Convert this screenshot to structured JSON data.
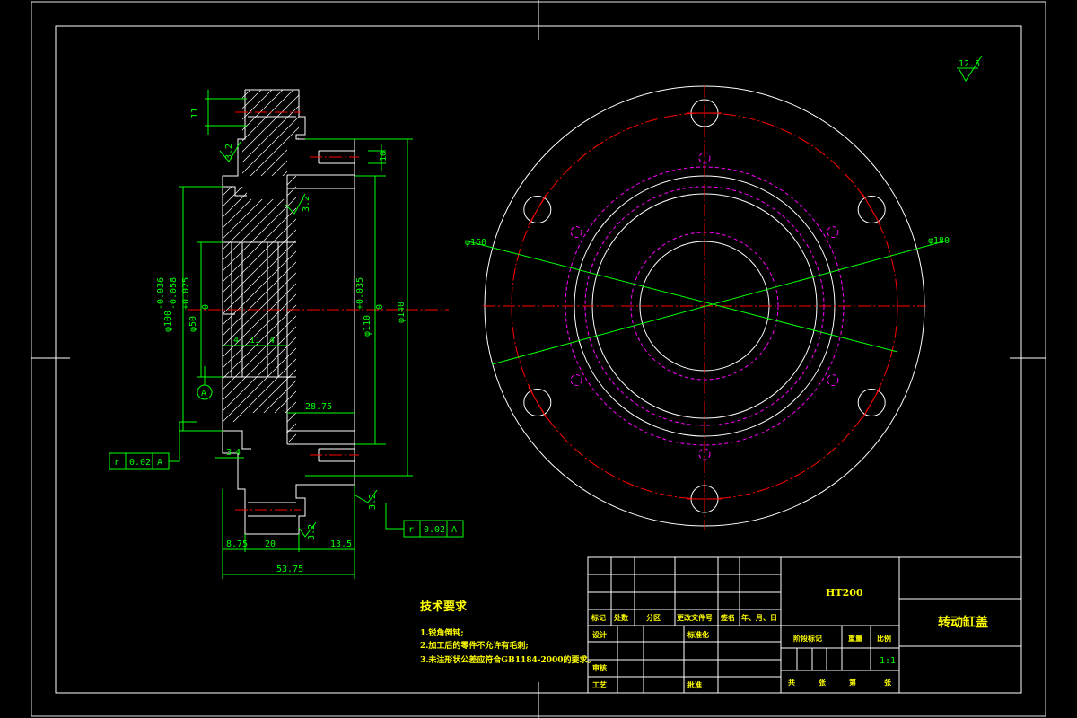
{
  "colors": {
    "background": "#000000",
    "outline": "#ffffff",
    "centerline": "#ff0000",
    "hidden": "#ff00ff",
    "dimension": "#00ff00",
    "text": "#ffff00"
  },
  "roughness": {
    "corner": "12.5",
    "r1": "3.2",
    "r2": "3.2",
    "r3": "3.2",
    "r4": "3.2"
  },
  "datum_label": "A",
  "section_dims": {
    "d11": "11",
    "d10": "10",
    "d100_tol_upper": "-0.036",
    "d100_tol_lower": "-0.058",
    "d100_main": "φ100",
    "d50_main": "φ50",
    "d50_tol_upper": "+0.025",
    "d50_tol_lower": "0",
    "d110_main": "φ110",
    "d110_tol_upper": "+0.035",
    "d110_tol_lower": "0",
    "d140": "φ140",
    "groove_a": "4",
    "groove_mid": "11",
    "groove_b": "4",
    "depth": "28.75",
    "d3": "3",
    "d4": "4",
    "len_875": "8.75",
    "len_20": "20",
    "len_135": "13.5",
    "overall": "53.75"
  },
  "tolerance_frames": [
    {
      "symbol": "r",
      "value": "0.02",
      "datum": "A"
    },
    {
      "symbol": "r",
      "value": "0.02",
      "datum": "A"
    }
  ],
  "front_view": {
    "d160": "φ160",
    "d180": "φ180"
  },
  "tech": {
    "title": "技术要求",
    "items": [
      "1.锐角倒钝;",
      "2.加工后的零件不允许有毛刺;",
      "3.未注形状公差应符合GB1184-2000的要求。"
    ]
  },
  "title_block": {
    "material": "HT200",
    "part_name": "转动缸盖",
    "row_labels": [
      "标记",
      "处数",
      "分区",
      "更改文件号",
      "签名",
      "年、月、日"
    ],
    "design": "设计",
    "standardize": "标准化",
    "review": "审核",
    "process": "工艺",
    "approve": "批准",
    "stage_mark": "阶段标记",
    "weight": "重量",
    "scale_label": "比例",
    "scale": "1:1",
    "footer": [
      "共",
      "张",
      "第",
      "张"
    ]
  }
}
